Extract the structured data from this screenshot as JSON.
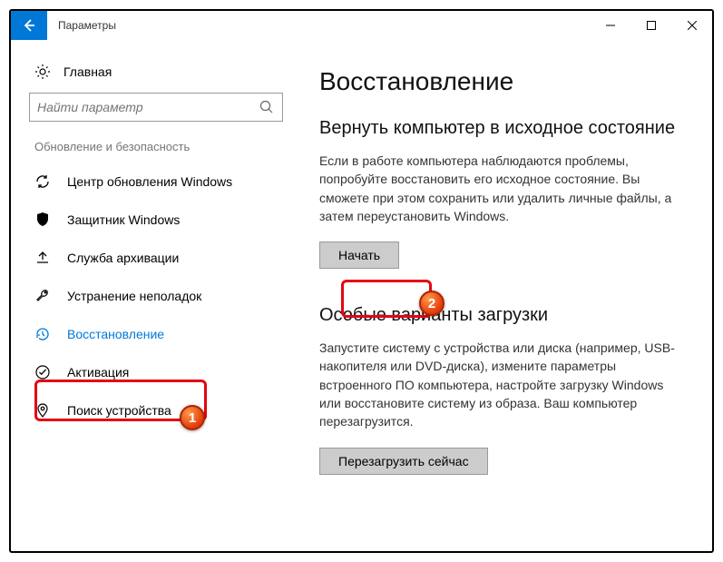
{
  "window": {
    "title": "Параметры"
  },
  "sidebar": {
    "home_label": "Главная",
    "search_placeholder": "Найти параметр",
    "category_label": "Обновление и безопасность",
    "items": [
      {
        "label": "Центр обновления Windows"
      },
      {
        "label": "Защитник Windows"
      },
      {
        "label": "Служба архивации"
      },
      {
        "label": "Устранение неполадок"
      },
      {
        "label": "Восстановление"
      },
      {
        "label": "Активация"
      },
      {
        "label": "Поиск устройства"
      }
    ]
  },
  "main": {
    "page_title": "Восстановление",
    "section1": {
      "heading": "Вернуть компьютер в исходное состояние",
      "text": "Если в работе компьютера наблюдаются проблемы, попробуйте восстановить его исходное состояние. Вы сможете при этом сохранить или удалить личные файлы, а затем переустановить Windows.",
      "button": "Начать"
    },
    "section2": {
      "heading": "Особые варианты загрузки",
      "text": "Запустите систему с устройства или диска (например, USB-накопителя или DVD-диска), измените параметры встроенного ПО компьютера, настройте загрузку Windows или восстановите систему из образа. Ваш компьютер перезагрузится.",
      "button": "Перезагрузить сейчас"
    }
  },
  "annotations": {
    "badge1": "1",
    "badge2": "2"
  }
}
